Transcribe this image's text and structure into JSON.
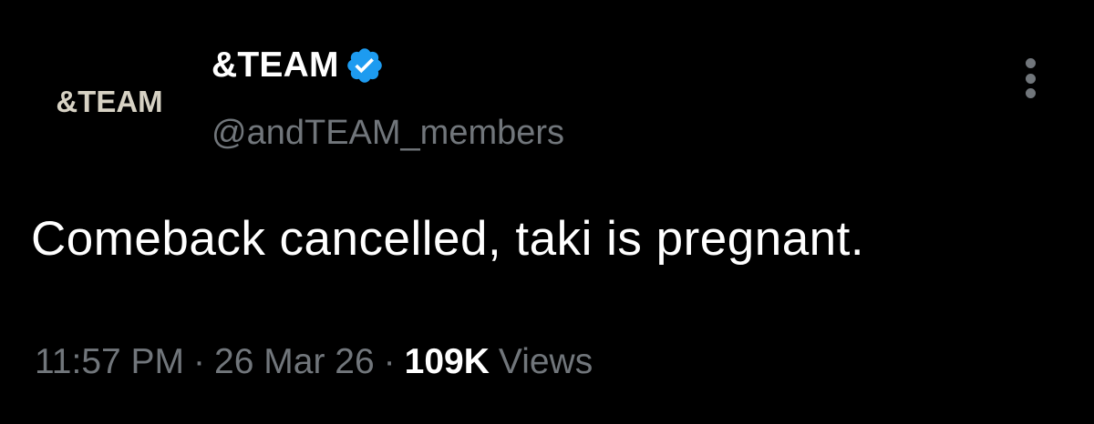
{
  "tweet": {
    "author": {
      "avatar_logo_text": "&TEAM",
      "display_name": "&TEAM",
      "verified": true,
      "handle": "@andTEAM_members"
    },
    "text": "Comeback cancelled, taki is pregnant.",
    "meta": {
      "time": "11:57 PM",
      "separator": "·",
      "date": "26 Mar 26",
      "views_count": "109K",
      "views_label": "Views"
    }
  },
  "icons": {
    "verified": "verified-badge-icon",
    "more": "more-vertical-icon"
  },
  "colors": {
    "background": "#000000",
    "primary_text": "#ffffff",
    "secondary_text": "#71767b",
    "verified_blue": "#1d9bf0",
    "avatar_logo": "#d7d2c4"
  }
}
